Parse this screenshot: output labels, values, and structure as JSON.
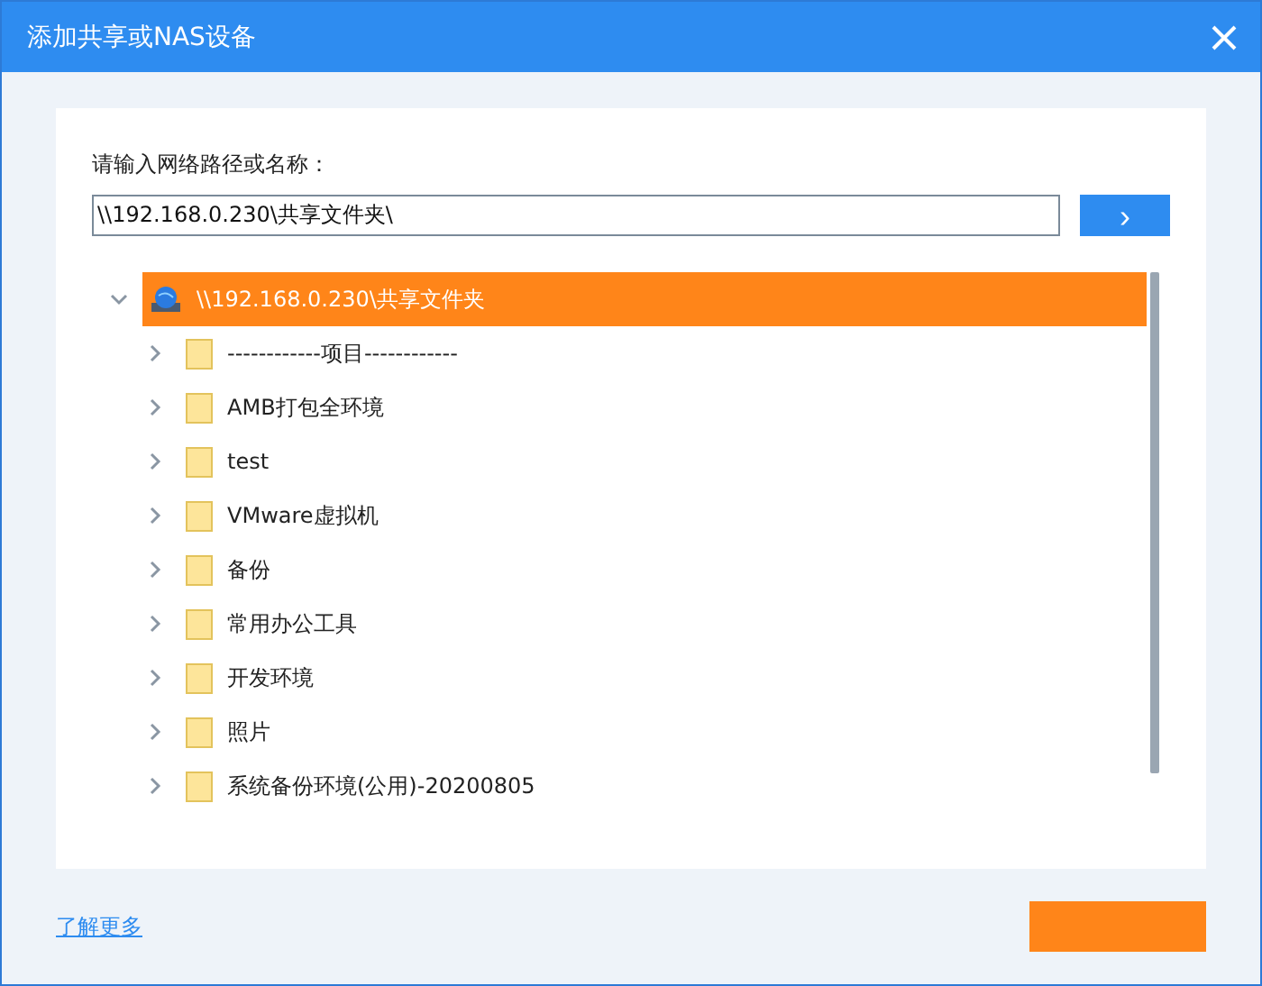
{
  "window": {
    "title": "添加共享或NAS设备"
  },
  "path_label": "请输入网络路径或名称：",
  "path_field": {
    "value": "\\\\192.168.0.230\\共享文件夹\\"
  },
  "go_button": {
    "label": "›"
  },
  "tree": {
    "root": {
      "label": "\\\\192.168.0.230\\共享文件夹",
      "expanded": true,
      "selected": true,
      "children": [
        {
          "label": "------------项目------------",
          "expanded": false,
          "selected": false
        },
        {
          "label": "AMB打包全环境",
          "expanded": false,
          "selected": false
        },
        {
          "label": "test",
          "expanded": false,
          "selected": false
        },
        {
          "label": "VMware虚拟机",
          "expanded": false,
          "selected": false
        },
        {
          "label": "备份",
          "expanded": false,
          "selected": false
        },
        {
          "label": "常用办公工具",
          "expanded": false,
          "selected": false
        },
        {
          "label": "开发环境",
          "expanded": false,
          "selected": false
        },
        {
          "label": "照片",
          "expanded": false,
          "selected": false
        },
        {
          "label": "系统备份环境(公用)-20200805",
          "expanded": false,
          "selected": false
        }
      ]
    }
  },
  "learn_more_link": "了解更多"
}
